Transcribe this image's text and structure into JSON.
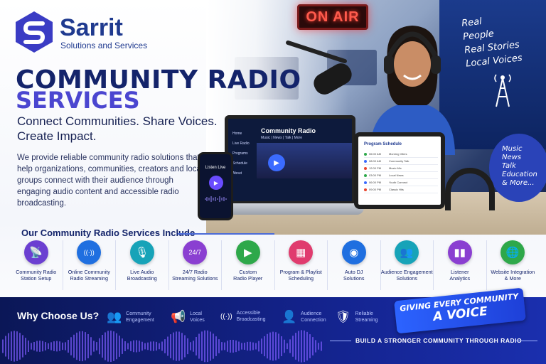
{
  "brand": {
    "name": "Sarrit",
    "subtitle": "Solutions and Services"
  },
  "hero": {
    "title_line1": "COMMUNITY RADIO",
    "title_line2": "SERVICES",
    "tagline": "Connect Communities. Share Voices. Create Impact.",
    "description": "We provide reliable community radio solutions that help organizations, communities, creators and local groups connect with their audience through engaging audio content and accessible radio broadcasting."
  },
  "studio": {
    "on_air": "ON AIR",
    "side_lines": [
      "Real",
      "People",
      "Real Stories",
      "Local Voices"
    ],
    "bubble_lines": [
      "Music",
      "News",
      "Talk",
      "Education",
      "& More..."
    ]
  },
  "laptop": {
    "menu": [
      "Home",
      "Live Radio",
      "Programs",
      "Schedule",
      "About"
    ],
    "title": "Community Radio",
    "subtitle": "Music | News | Talk | More"
  },
  "phone": {
    "title": "Listen Live"
  },
  "tablet": {
    "title": "Program Schedule",
    "rows": [
      {
        "time": "06:00 AM",
        "show": "Morning Vibes",
        "color": "#2ea84a"
      },
      {
        "time": "08:00 AM",
        "show": "Community Talk",
        "color": "#3b6bff"
      },
      {
        "time": "12:00 PM",
        "show": "Music Mix",
        "color": "#e8452e"
      },
      {
        "time": "03:00 PM",
        "show": "Local News",
        "color": "#2ea84a"
      },
      {
        "time": "06:00 PM",
        "show": "Youth Connect",
        "color": "#3b6bff"
      },
      {
        "time": "09:00 PM",
        "show": "Classic Hits",
        "color": "#e8452e"
      }
    ]
  },
  "services": {
    "heading": "Our Community Radio Services Include",
    "items": [
      {
        "label": "Community Radio\nStation Setup",
        "icon": "radio-tower-icon",
        "glyph": "📡",
        "color": "#6b3fd1"
      },
      {
        "label": "Online Community\nRadio Streaming",
        "icon": "broadcast-icon",
        "glyph": "((·))",
        "color": "#1f6fe0"
      },
      {
        "label": "Live Audio\nBroadcasting",
        "icon": "microphone-icon",
        "glyph": "🎙",
        "color": "#17a3b8"
      },
      {
        "label": "24/7 Radio\nStreaming Solutions",
        "icon": "clock-24-icon",
        "glyph": "24/7",
        "color": "#8a3fd1"
      },
      {
        "label": "Custom\nRadio Player",
        "icon": "player-icon",
        "glyph": "▶",
        "color": "#2ea84a"
      },
      {
        "label": "Program & Playlist\nScheduling",
        "icon": "calendar-icon",
        "glyph": "▦",
        "color": "#e03b6e"
      },
      {
        "label": "Auto DJ\nSolutions",
        "icon": "robot-icon",
        "glyph": "◉",
        "color": "#1f6fe0"
      },
      {
        "label": "Audience Engagement\nSolutions",
        "icon": "people-icon",
        "glyph": "👥",
        "color": "#17a3b8"
      },
      {
        "label": "Listener\nAnalytics",
        "icon": "analytics-icon",
        "glyph": "▮▮",
        "color": "#8a3fd1"
      },
      {
        "label": "Website Integration\n& More",
        "icon": "globe-icon",
        "glyph": "🌐",
        "color": "#2ea84a"
      }
    ]
  },
  "footer": {
    "why_heading": "Why Choose Us?",
    "features": [
      {
        "label": "Community\nEngagement",
        "icon": "community-icon",
        "glyph": "👥"
      },
      {
        "label": "Local\nVoices",
        "icon": "megaphone-icon",
        "glyph": "📢"
      },
      {
        "label": "Accessible\nBroadcasting",
        "icon": "antenna-icon",
        "glyph": "((·))"
      },
      {
        "label": "Audience\nConnection",
        "icon": "audience-icon",
        "glyph": "👤"
      },
      {
        "label": "Reliable\nStreaming",
        "icon": "shield-icon",
        "glyph": "🛡"
      }
    ],
    "banner_line1": "GIVING EVERY COMMUNITY",
    "banner_line2": "A VOICE",
    "cta": "BUILD A STRONGER COMMUNITY THROUGH RADIO"
  }
}
